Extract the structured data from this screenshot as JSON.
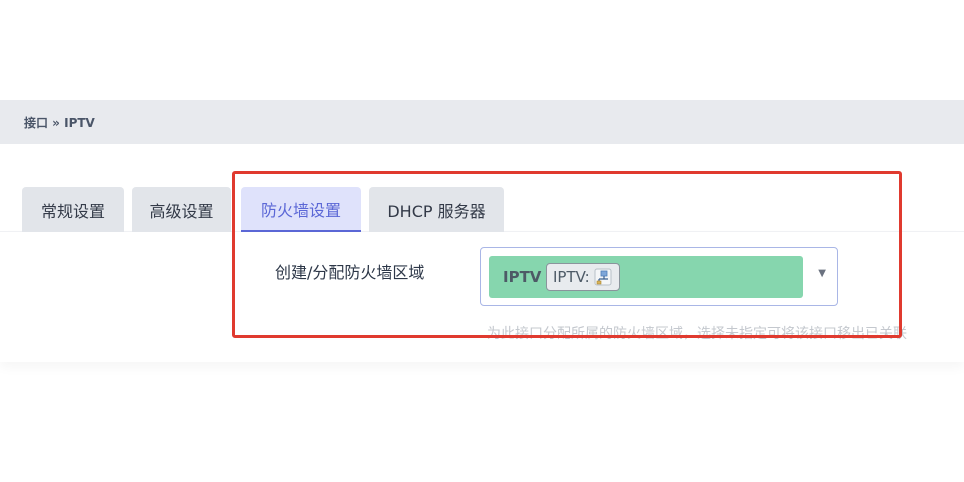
{
  "breadcrumb": "接口 » IPTV",
  "tabs": [
    {
      "label": "常规设置",
      "active": false
    },
    {
      "label": "高级设置",
      "active": false
    },
    {
      "label": "防火墙设置",
      "active": true
    },
    {
      "label": "DHCP 服务器",
      "active": false
    }
  ],
  "firewall": {
    "label": "创建/分配防火墙区域",
    "zone_name": "IPTV",
    "zone_interface": "IPTV:",
    "zone_color": "#86d6ae",
    "help_text": "为此接口分配所属的防火墙区域，选择未指定可将该接口移出已关联"
  },
  "colors": {
    "accent": "#5b67d6",
    "highlight": "#e03a2f"
  }
}
